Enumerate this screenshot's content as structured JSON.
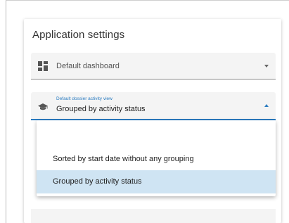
{
  "settings": {
    "title": "Application settings",
    "dashboard_field": {
      "value": "Default dashboard",
      "icon": "dashboard-icon"
    },
    "activity_view_field": {
      "label": "Default dossier activity view",
      "value": "Grouped by activity status",
      "icon": "graduation-cap-icon"
    },
    "dropdown": {
      "options": [
        {
          "label": "Sorted by start date without any grouping",
          "selected": false
        },
        {
          "label": "Grouped by activity status",
          "selected": true
        }
      ]
    }
  },
  "colors": {
    "accent": "#2a7bc0",
    "selected_option_bg": "#cfe4f3",
    "field_bg": "#f4f4f4"
  }
}
